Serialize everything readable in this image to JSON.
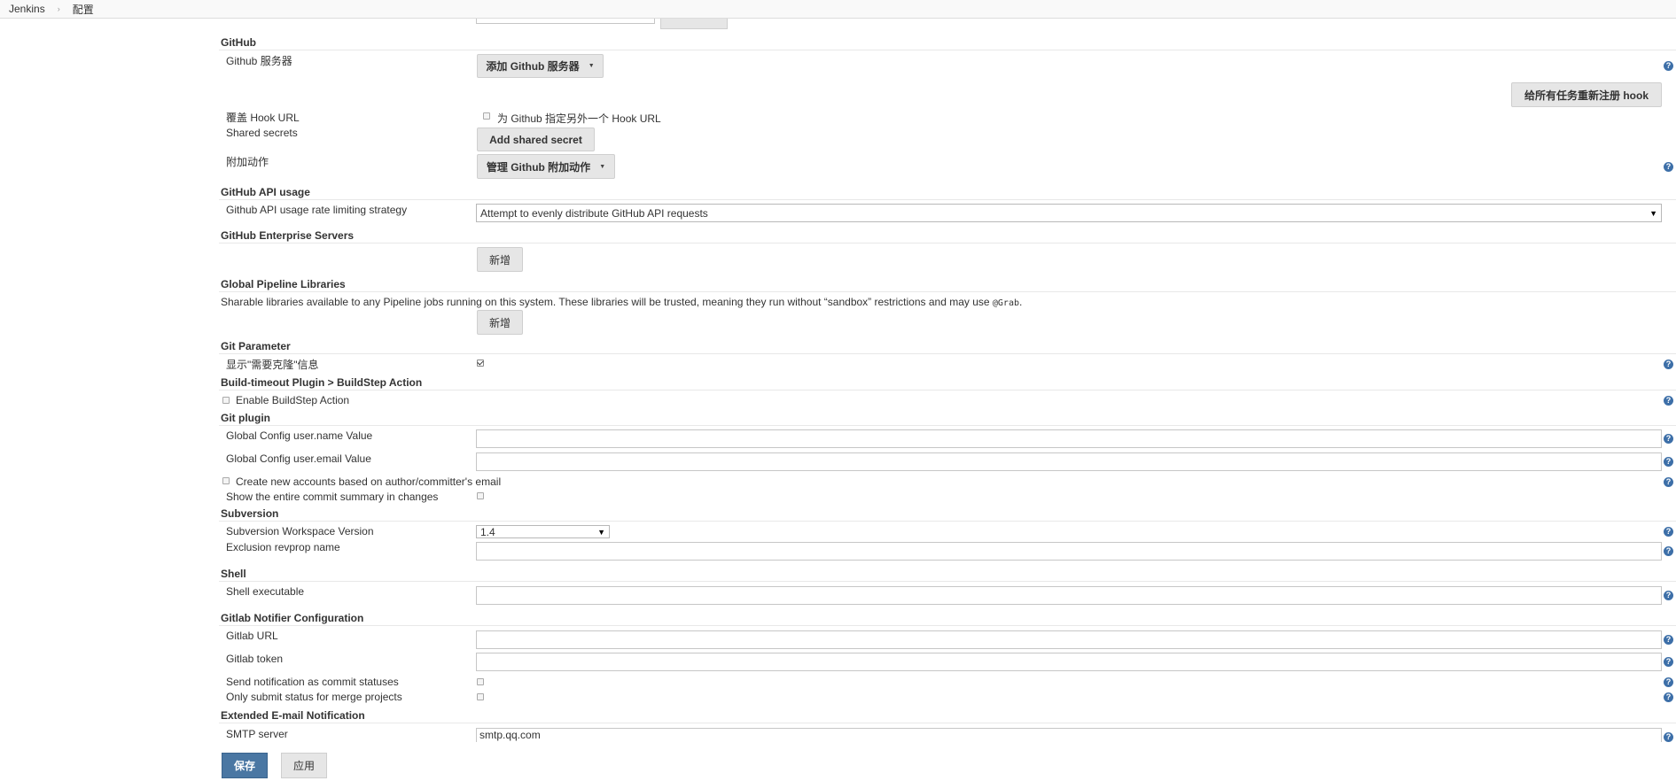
{
  "breadcrumb": {
    "items": [
      "Jenkins",
      "配置"
    ],
    "separator": "›"
  },
  "github": {
    "section_title": "GitHub",
    "servers_label": "Github 服务器",
    "add_server_button": "添加 Github 服务器",
    "reregister_hooks_button": "给所有任务重新注册 hook",
    "override_hook_label": "覆盖 Hook URL",
    "override_hook_checkbox_label": "为 Github 指定另外一个 Hook URL",
    "shared_secrets_label": "Shared secrets",
    "add_shared_secret_button": "Add shared secret",
    "additional_actions_label": "附加动作",
    "manage_actions_button": "管理 Github 附加动作"
  },
  "github_api": {
    "section_title": "GitHub API usage",
    "strategy_label": "Github API usage rate limiting strategy",
    "strategy_value": "Attempt to evenly distribute GitHub API requests"
  },
  "github_enterprise": {
    "section_title": "GitHub Enterprise Servers",
    "add_button": "新增"
  },
  "pipeline_libraries": {
    "section_title": "Global Pipeline Libraries",
    "description_prefix": "Sharable libraries available to any Pipeline jobs running on this system. These libraries will be trusted, meaning they run without “sandbox” restrictions and may use ",
    "description_code": "@Grab",
    "description_suffix": ".",
    "add_button": "新增"
  },
  "git_parameter": {
    "section_title": "Git Parameter",
    "show_clone_label": "显示\"需要克隆\"信息",
    "show_clone_checked": true
  },
  "build_timeout": {
    "section_title": "Build-timeout Plugin > BuildStep Action",
    "enable_label": "Enable BuildStep Action",
    "enable_checked": false
  },
  "git_plugin": {
    "section_title": "Git plugin",
    "user_name_label": "Global Config user.name Value",
    "user_name_value": "",
    "user_email_label": "Global Config user.email Value",
    "user_email_value": "",
    "create_accounts_label": "Create new accounts based on author/committer's email",
    "show_summary_label": "Show the entire commit summary in changes"
  },
  "subversion": {
    "section_title": "Subversion",
    "workspace_version_label": "Subversion Workspace Version",
    "workspace_version_value": "1.4",
    "exclusion_label": "Exclusion revprop name",
    "exclusion_value": ""
  },
  "shell": {
    "section_title": "Shell",
    "executable_label": "Shell executable",
    "executable_value": ""
  },
  "gitlab": {
    "section_title": "Gitlab Notifier Configuration",
    "url_label": "Gitlab URL",
    "url_value": "",
    "token_label": "Gitlab token",
    "token_value": "",
    "send_notification_label": "Send notification as commit statuses",
    "only_merge_label": "Only submit status for merge projects"
  },
  "email": {
    "section_title": "Extended E-mail Notification",
    "smtp_label": "SMTP server",
    "smtp_value": "smtp.qq.com"
  },
  "footer": {
    "save_button": "保存",
    "apply_button": "应用"
  },
  "help_icon_glyph": "?",
  "colors": {
    "save_button": "#4a77a3",
    "help_icon": "#3d6fa8",
    "button_bg": "#e6e6e6"
  }
}
